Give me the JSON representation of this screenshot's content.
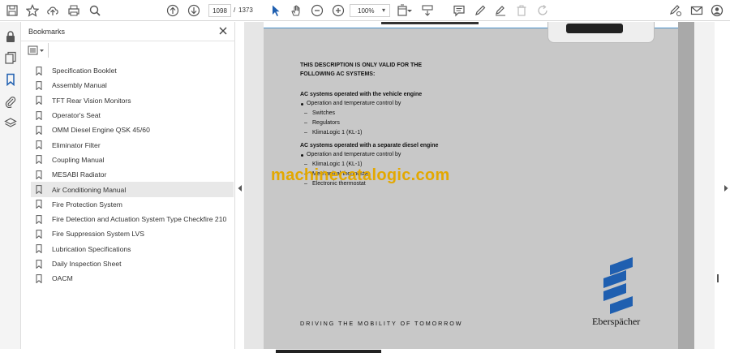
{
  "toolbar": {
    "page_current": "1098",
    "page_separator": "/",
    "page_total": "1373",
    "zoom": "100%",
    "icons": [
      "save-icon",
      "star-icon",
      "upload-icon",
      "print-icon",
      "zoom-search-icon",
      "arrow-up-icon",
      "arrow-down-icon",
      "pointer-icon",
      "hand-icon",
      "zoom-out-icon",
      "zoom-in-icon",
      "fit-page-icon",
      "scroll-mode-icon",
      "comment-icon",
      "pen-icon",
      "highlight-icon",
      "delete-icon",
      "rotate-icon",
      "sign-icon",
      "mail-icon",
      "account-icon"
    ]
  },
  "rail": {
    "icons": [
      "lock-icon",
      "pages-icon",
      "bookmark-icon",
      "attachment-icon",
      "layers-icon"
    ]
  },
  "bookmarks": {
    "title": "Bookmarks",
    "items": [
      {
        "label": "Specification Booklet"
      },
      {
        "label": "Assembly Manual"
      },
      {
        "label": "TFT Rear Vision Monitors"
      },
      {
        "label": "Operator's Seat"
      },
      {
        "label": "OMM Diesel Engine QSK 45/60"
      },
      {
        "label": "Eliminator Filter"
      },
      {
        "label": "Coupling Manual"
      },
      {
        "label": "MESABI Radiator"
      },
      {
        "label": "Air Conditioning Manual",
        "selected": true
      },
      {
        "label": "Fire Protection System"
      },
      {
        "label": "Fire Detection and Actuation System Type Checkfire 210"
      },
      {
        "label": "Fire Suppression System LVS"
      },
      {
        "label": "Lubrication Specifications"
      },
      {
        "label": "Daily Inspection Sheet"
      },
      {
        "label": "OACM"
      }
    ]
  },
  "document": {
    "heading_line1": "THIS DESCRIPTION IS ONLY VALID FOR THE",
    "heading_line2": "FOLLOWING AC SYSTEMS:",
    "section1_title": "AC systems operated with the vehicle engine",
    "section1_bullet": "Operation and temperature control by",
    "section1_items": [
      "Switches",
      "Regulators",
      "KlimaLogic 1 (KL-1)"
    ],
    "section2_title": "AC systems operated with a separate diesel engine",
    "section2_bullet": "Operation and temperature control by",
    "section2_items": [
      "KlimaLogic 1 (KL-1)",
      "Mechanical thermostat",
      "Electronic thermostat"
    ],
    "tagline": "DRIVING THE MOBILITY OF TOMORROW",
    "brand": "Eberspächer",
    "watermark": "machinecatalogic.com"
  },
  "colors": {
    "watermark": "#e3a800",
    "logo_blue": "#1f5fb0",
    "page_bg": "#c8c8c8"
  }
}
